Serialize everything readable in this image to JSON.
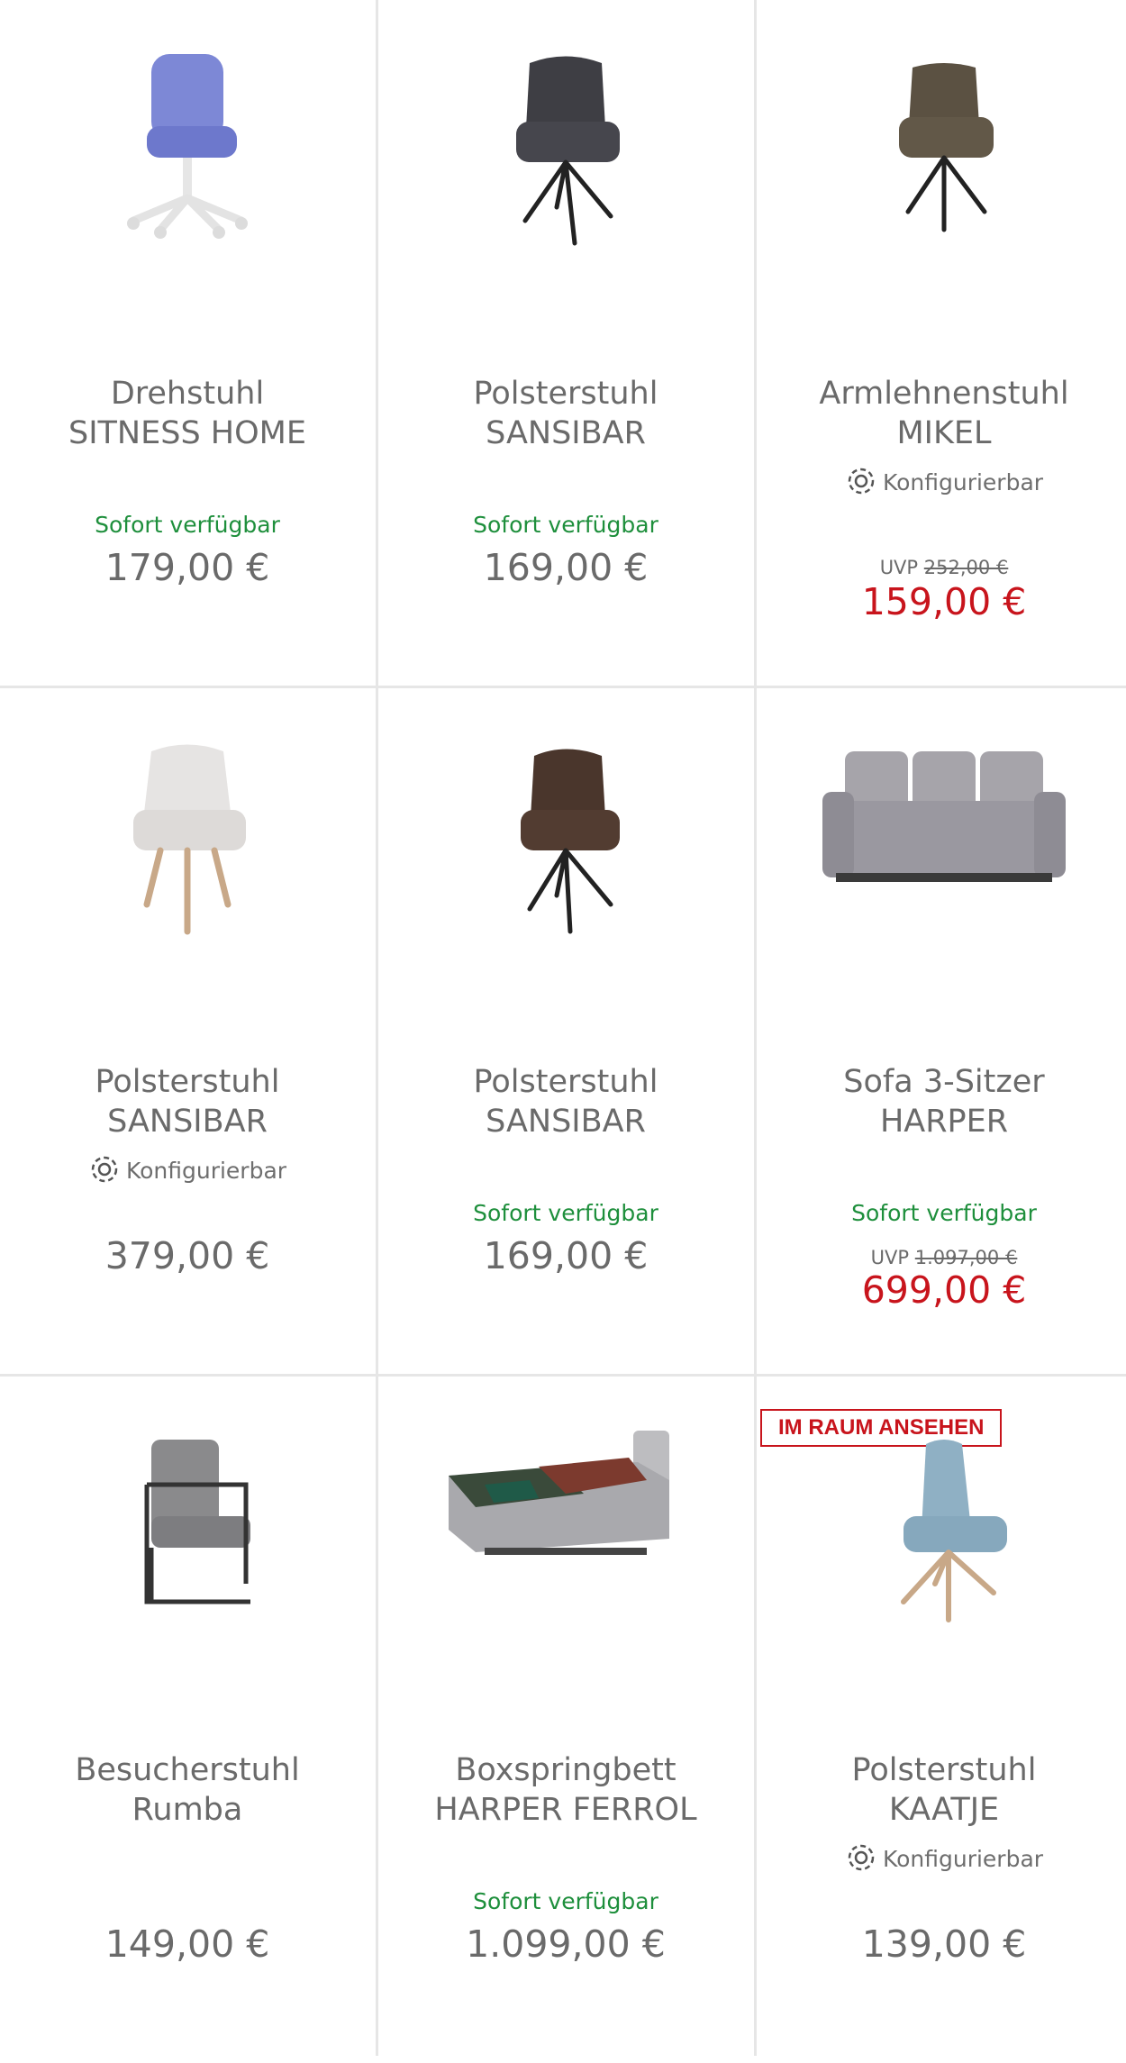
{
  "products": [
    {
      "title1": "Drehstuhl",
      "title2": "SITNESS HOME",
      "availability": "Sofort verfügbar",
      "price": "179,00 €",
      "image": "office-chair-blue"
    },
    {
      "title1": "Polsterstuhl",
      "title2": "SANSIBAR",
      "availability": "Sofort verfügbar",
      "price": "169,00 €",
      "image": "armchair-anthracite"
    },
    {
      "title1": "Armlehnenstuhl",
      "title2": "MIKEL",
      "config": "Konfigurierbar",
      "uvp_label": "UVP",
      "uvp_old": "252,00 €",
      "sale_price": "159,00 €",
      "image": "armchair-olive"
    },
    {
      "title1": "Polsterstuhl",
      "title2": "SANSIBAR",
      "config": "Konfigurierbar",
      "price": "379,00 €",
      "image": "armchair-white-wood"
    },
    {
      "title1": "Polsterstuhl",
      "title2": "SANSIBAR",
      "availability": "Sofort verfügbar",
      "price": "169,00 €",
      "image": "armchair-brown"
    },
    {
      "title1": "Sofa 3-Sitzer",
      "title2": "HARPER",
      "availability": "Sofort verfügbar",
      "uvp_label": "UVP",
      "uvp_old": "1.097,00 €",
      "sale_price": "699,00 €",
      "image": "sofa-grey"
    },
    {
      "title1": "Besucherstuhl",
      "title2": "Rumba",
      "price": "149,00 €",
      "image": "cantilever-chair-grey"
    },
    {
      "title1": "Boxspringbett",
      "title2": "HARPER FERROL",
      "availability": "Sofort verfügbar",
      "price": "1.099,00 €",
      "image": "boxspring-bed"
    },
    {
      "title1": "Polsterstuhl",
      "title2": "KAATJE",
      "config": "Konfigurierbar",
      "price": "139,00 €",
      "badge": "IM RAUM ANSEHEN",
      "image": "chair-lightblue-wood"
    }
  ],
  "colors": {
    "available": "#1e8f3c",
    "sale": "#c8141c",
    "text": "#6a6a6a",
    "divider": "#e6e6e6"
  }
}
